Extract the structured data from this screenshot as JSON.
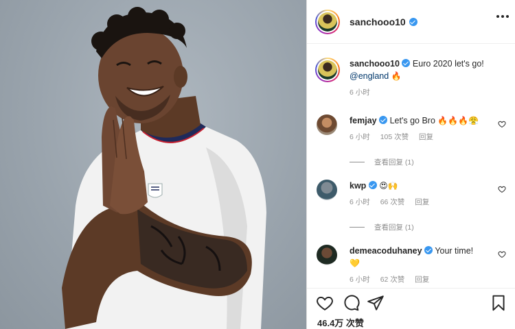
{
  "post": {
    "author": "sanchooo10",
    "photo_icon": "player-portrait"
  },
  "caption": {
    "username": "sanchooo10",
    "text": "Euro 2020 let's go!",
    "mention": "@england",
    "emoji": "🔥",
    "time": "6 小时"
  },
  "comments": [
    {
      "username": "femjay",
      "text": "Let's go Bro",
      "emojis": "🔥🔥🔥😤",
      "time": "6 小时",
      "likes": "105 次赞",
      "reply": "回复",
      "view_replies": "查看回复 (1)"
    },
    {
      "username": "kwp",
      "text": "",
      "emojis": "😍🙌",
      "time": "6 小时",
      "likes": "66 次赞",
      "reply": "回复",
      "view_replies": "查看回复 (1)"
    },
    {
      "username": "demeacoduhaney",
      "text": "Your time!",
      "emojis": "💛",
      "time": "6 小时",
      "likes": "62 次赞",
      "reply": "回复"
    }
  ],
  "footer": {
    "likes": "46.4万 次赞"
  },
  "colors": {
    "verified": "#3897f0",
    "text": "#262626",
    "muted": "#8e8e8e",
    "mention": "#00376b"
  }
}
